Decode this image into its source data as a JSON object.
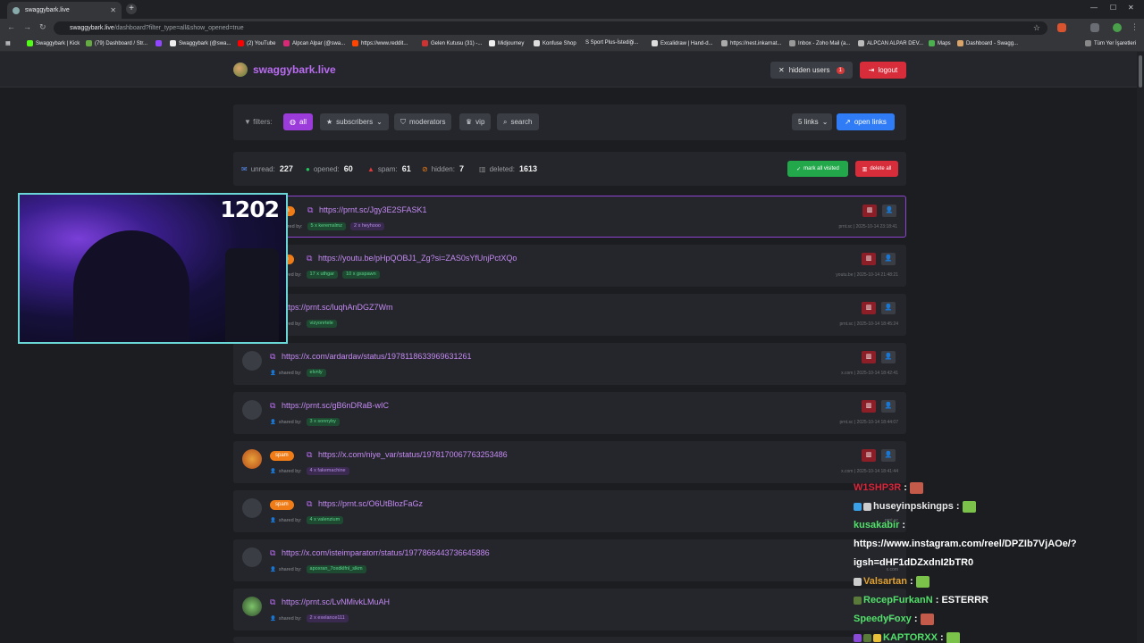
{
  "browser": {
    "tab_title": "swaggybark.live",
    "url_host": "swaggybark.live",
    "url_path": "/dashboard?filter_type=all&show_opened=true",
    "bookmarks": [
      "Swaggybark | Kick",
      "(79) Dashboard / Str...",
      "",
      "Swaggybark (@swa...",
      "(2) YouTube",
      "Alpcan Alpar (@swa...",
      "https://www.reddit...",
      "Gelen Kutusu (31) -...",
      "Midjourney",
      "Konfuse Shop",
      "S Sport Plus-İstediği...",
      "Excalidraw | Hand-d...",
      "https://nest.inkarnat...",
      "Inbox - Zoho Mail (a...",
      "ALPCAN ALPAR DEV...",
      "Maps",
      "Dashboard - Swagg..."
    ],
    "all_bookmarks": "Tüm Yer İşaretleri"
  },
  "header": {
    "brand": "swaggybark.live",
    "hidden_users_label": "hidden users",
    "hidden_users_count": "1",
    "logout_label": "logout"
  },
  "filters": {
    "label": "filters:",
    "items": [
      "all",
      "subscribers",
      "moderators",
      "vip",
      "search"
    ],
    "active": "all",
    "links_select": "5 links",
    "open_links": "open links"
  },
  "stats": {
    "unread_label": "unread:",
    "unread": "227",
    "opened_label": "opened:",
    "opened": "60",
    "spam_label": "spam:",
    "spam": "61",
    "hidden_label": "hidden:",
    "hidden": "7",
    "deleted_label": "deleted:",
    "deleted": "1613",
    "mark_all_visited": "mark all visited",
    "delete_all": "delete all"
  },
  "rows": [
    {
      "url": "https://prnt.sc/Jgy3E2SFASK1",
      "spam": "spam",
      "shared_by": "shared by:",
      "tags": [
        "5 x keremslmz",
        "2 x heyhooo"
      ],
      "domain": "prnt.sc",
      "date": "2025-10-14 23:18:41"
    },
    {
      "url": "https://youtu.be/pHpQOBJ1_Zg?si=ZAS0sYfUnjPctXQo",
      "spam": "spam",
      "shared_by": "shared by:",
      "tags": [
        "17 x uthgar",
        "10 x gsspawn"
      ],
      "domain": "youtu.be",
      "date": "2025-10-14 21:48:21"
    },
    {
      "url": "https://prnt.sc/luqhAnDGZ7Wm",
      "spam": "",
      "shared_by": "shared by:",
      "tags": [
        "vizyonrtele"
      ],
      "domain": "prnt.sc",
      "date": "2025-10-14 18:45:24"
    },
    {
      "url": "https://x.com/ardardav/status/1978118633969631261",
      "spam": "",
      "shared_by": "shared by:",
      "tags": [
        "elvnly"
      ],
      "domain": "x.com",
      "date": "2025-10-14 18:42:41"
    },
    {
      "url": "https://prnt.sc/gB6nDRaB-wIC",
      "spam": "",
      "shared_by": "shared by:",
      "tags": [
        "3 x sonnyby"
      ],
      "domain": "prnt.sc",
      "date": "2025-10-14 18:44:07"
    },
    {
      "url": "https://x.com/niye_var/status/1978170067763253486",
      "spam": "spam",
      "shared_by": "shared by:",
      "tags": [
        "4 x fakemachine"
      ],
      "domain": "x.com",
      "date": "2025-10-14 18:41:44"
    },
    {
      "url": "https://prnt.sc/O6UtBlozFaGz",
      "spam": "spam",
      "shared_by": "shared by:",
      "tags": [
        "4 x valenzium"
      ],
      "domain": "prnt.sc",
      "date": ""
    },
    {
      "url": "https://x.com/isteimparatorr/status/1977866443736645886",
      "spam": "",
      "shared_by": "shared by:",
      "tags": [
        "apoxran_7oxdklfnl_slkm"
      ],
      "domain": "x.com",
      "date": ""
    },
    {
      "url": "https://prnt.sc/LvNMivkLMuAH",
      "spam": "",
      "shared_by": "shared by:",
      "tags": [
        "2 x exelance111"
      ],
      "domain": "prnt.sc",
      "date": ""
    }
  ],
  "webcam": {
    "count": "1202"
  },
  "chat": [
    {
      "user": "W1SHP3R",
      "color": "#d8253a",
      "sep": " :",
      "msg": ""
    },
    {
      "user": "huseyinpskingps",
      "color": "#e8e8e8",
      "sep": " :",
      "msg": ""
    },
    {
      "user": "kusakabir",
      "color": "#52e06a",
      "sep": " :",
      "msg": ""
    },
    {
      "user": "",
      "color": "#ffffff",
      "sep": "",
      "msg": "https://www.instagram.com/reel/DPZIb7VjAOe/?"
    },
    {
      "user": "",
      "color": "#ffffff",
      "sep": "",
      "msg": "igsh=dHF1dDZxdnI2bTR0"
    },
    {
      "user": "Valsartan",
      "color": "#e0a030",
      "sep": " :",
      "msg": ""
    },
    {
      "user": "RecepFurkanN",
      "color": "#52e06a",
      "sep": " :",
      "msg": "ESTERRR"
    },
    {
      "user": "SpeedyFoxy",
      "color": "#52e06a",
      "sep": " :",
      "msg": ""
    },
    {
      "user": "KAPTORXX",
      "color": "#52e06a",
      "sep": " :",
      "msg": ""
    }
  ]
}
